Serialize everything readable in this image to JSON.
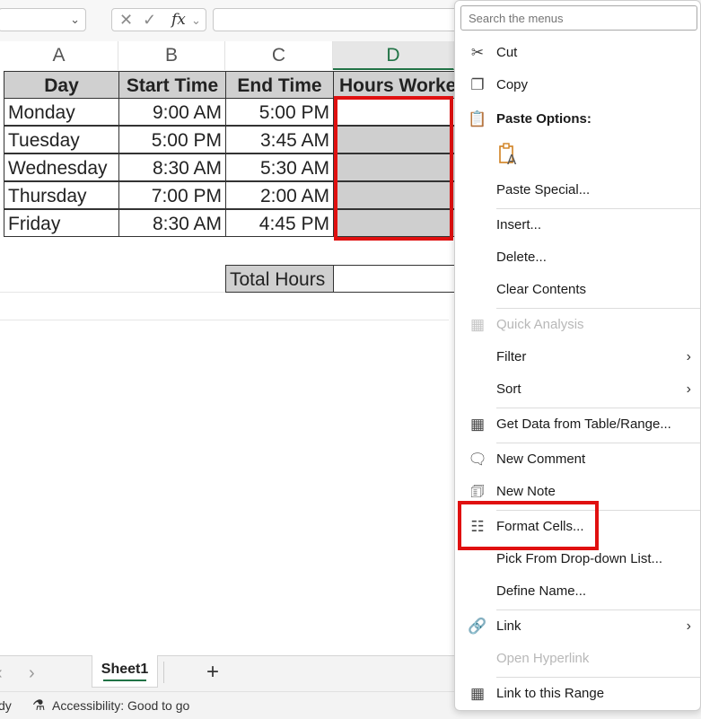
{
  "formula_bar": {
    "fx_label": "fx"
  },
  "columns": [
    "A",
    "B",
    "C",
    "D"
  ],
  "table": {
    "headers": [
      "Day",
      "Start Time",
      "End Time",
      "Hours Worke"
    ],
    "rows": [
      {
        "day": "Monday",
        "start": "9:00 AM",
        "end": "5:00 PM"
      },
      {
        "day": "Tuesday",
        "start": "5:00 PM",
        "end": "3:45 AM"
      },
      {
        "day": "Wednesday",
        "start": "8:30 AM",
        "end": "5:30 AM"
      },
      {
        "day": "Thursday",
        "start": "7:00 PM",
        "end": "2:00 AM"
      },
      {
        "day": "Friday",
        "start": "8:30 AM",
        "end": "4:45 PM"
      }
    ],
    "total_label": "Total Hours"
  },
  "sheet_tabs": {
    "active": "Sheet1",
    "add": "+"
  },
  "status_bar": {
    "ready": "dy",
    "accessibility": "Accessibility: Good to go"
  },
  "context_menu": {
    "search_placeholder": "Search the menus",
    "items": {
      "cut": "Cut",
      "copy": "Copy",
      "paste_options": "Paste Options:",
      "paste_special": "Paste Special...",
      "insert": "Insert...",
      "delete": "Delete...",
      "clear_contents": "Clear Contents",
      "quick_analysis": "Quick Analysis",
      "filter": "Filter",
      "sort": "Sort",
      "get_data": "Get Data from Table/Range...",
      "new_comment": "New Comment",
      "new_note": "New Note",
      "format_cells": "Format Cells...",
      "pick_dropdown": "Pick From Drop-down List...",
      "define_name": "Define Name...",
      "link": "Link",
      "open_hyperlink": "Open Hyperlink",
      "link_to_range": "Link to this Range"
    }
  },
  "colors": {
    "highlight_red": "#e01010",
    "excel_green": "#217346",
    "shaded_cell": "#cfcfcf"
  }
}
